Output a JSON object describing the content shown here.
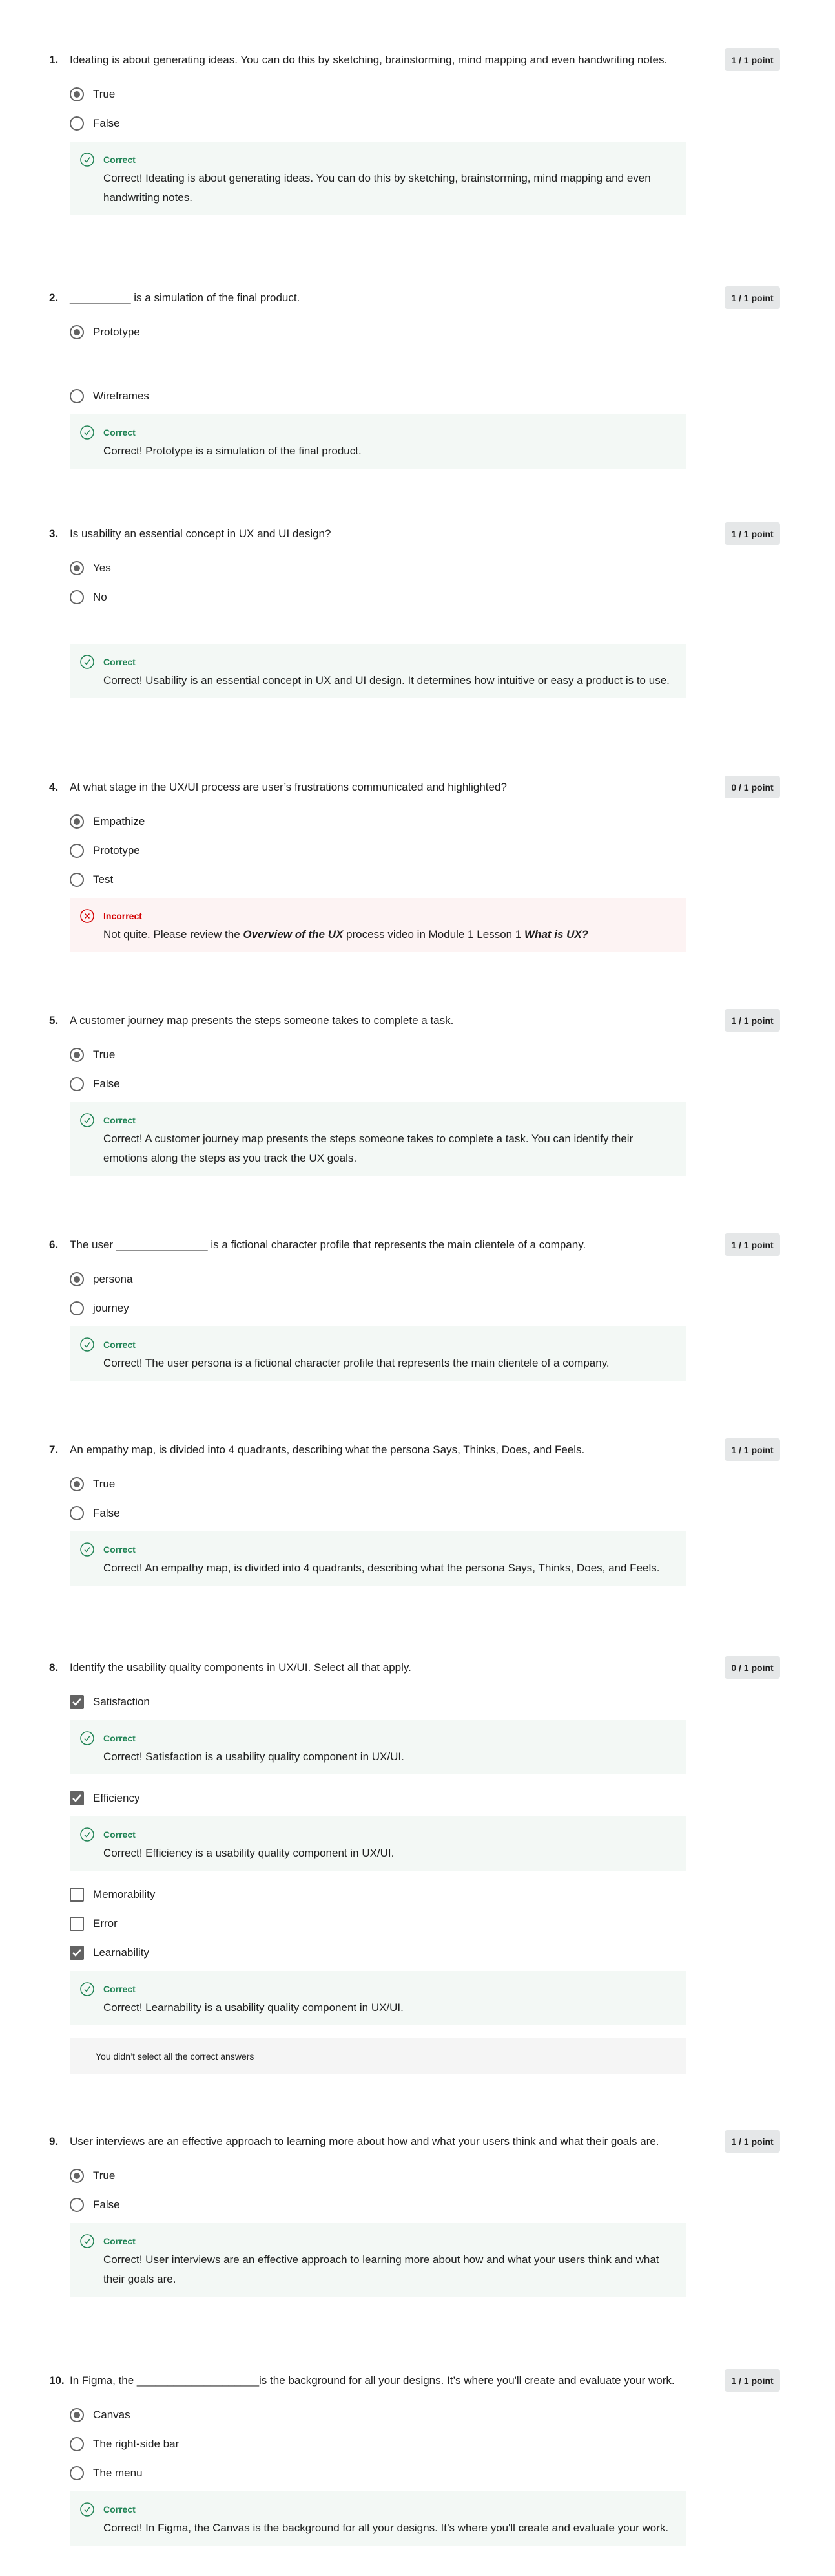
{
  "colors": {
    "correct": "#1f8354",
    "incorrect": "#d30001",
    "correct_bg": "#f3f8f5",
    "incorrect_bg": "#fdf3f3",
    "badge_bg": "#e5e7e8"
  },
  "labels": {
    "correct": "Correct",
    "incorrect": "Incorrect"
  },
  "questions": [
    {
      "num": "1.",
      "text": "Ideating is about generating ideas. You can do this by sketching, brainstorming, mind mapping and even handwriting notes.",
      "score": "1 / 1 point",
      "options": [
        {
          "label": "True",
          "selected": true
        },
        {
          "label": "False",
          "selected": false
        }
      ],
      "feedback": "Correct! Ideating is about generating ideas. You can do this by sketching, brainstorming, mind mapping and even handwriting notes."
    },
    {
      "num": "2.",
      "text": "__________ is a simulation of the final product.",
      "score": "1 / 1 point",
      "options": [
        {
          "label": "Prototype",
          "selected": true
        },
        {
          "label": "Wireframes",
          "selected": false
        }
      ],
      "feedback": "Correct! Prototype is a simulation of the final product."
    },
    {
      "num": "3.",
      "text": "Is usability an essential concept in UX and UI design?",
      "score": "1 / 1 point",
      "options": [
        {
          "label": "Yes",
          "selected": true
        },
        {
          "label": "No",
          "selected": false
        }
      ],
      "feedback": "Correct! Usability is an essential concept in UX and UI design. It determines how intuitive or easy a product is to use."
    },
    {
      "num": "4.",
      "text": "At what stage in the UX/UI process are user’s frustrations communicated and highlighted?",
      "score": "0 / 1 point",
      "options": [
        {
          "label": "Empathize",
          "selected": true
        },
        {
          "label": "Prototype",
          "selected": false
        },
        {
          "label": "Test",
          "selected": false
        }
      ],
      "feedback_parts": [
        "Not quite. Please review the ",
        "Overview of the UX",
        " process video in Module 1 Lesson 1 ",
        "What is UX?"
      ]
    },
    {
      "num": "5.",
      "text": "A customer journey map presents the steps someone takes to complete a task.",
      "score": "1 / 1 point",
      "options": [
        {
          "label": "True",
          "selected": true
        },
        {
          "label": "False",
          "selected": false
        }
      ],
      "feedback": "Correct! A customer journey map presents the steps someone takes to complete a task. You can identify their emotions along the steps as you track the UX goals."
    },
    {
      "num": "6.",
      "text": "The user _______________ is a fictional character profile that represents the main clientele of a company.",
      "score": "1 / 1 point",
      "options": [
        {
          "label": "persona",
          "selected": true
        },
        {
          "label": "journey",
          "selected": false
        }
      ],
      "feedback": "Correct! The user persona is a fictional character profile that represents the main clientele of a company."
    },
    {
      "num": "7.",
      "text": "An empathy map, is divided into 4 quadrants, describing what the persona Says, Thinks, Does, and Feels.",
      "score": "1 / 1 point",
      "options": [
        {
          "label": "True",
          "selected": true
        },
        {
          "label": "False",
          "selected": false
        }
      ],
      "feedback": "Correct! An empathy map, is divided into 4 quadrants, describing what the persona Says, Thinks, Does, and Feels."
    },
    {
      "num": "8.",
      "text": "Identify the usability quality components in UX/UI. Select all that apply.",
      "score": "0 / 1 point",
      "options": [
        {
          "label": "Satisfaction",
          "selected": true,
          "feedback": "Correct! Satisfaction is a usability quality component in UX/UI."
        },
        {
          "label": "Efficiency",
          "selected": true,
          "feedback": "Correct! Efficiency is a usability quality component in UX/UI."
        },
        {
          "label": "Memorability",
          "selected": false
        },
        {
          "label": "Error",
          "selected": false
        },
        {
          "label": "Learnability",
          "selected": true,
          "feedback": "Correct! Learnability is a usability quality component in UX/UI."
        }
      ],
      "note": "You didn’t select all the correct answers"
    },
    {
      "num": "9.",
      "text": "User interviews are an effective approach to learning more about how and what your users think and what their goals are.",
      "score": "1 / 1 point",
      "options": [
        {
          "label": "True",
          "selected": true
        },
        {
          "label": "False",
          "selected": false
        }
      ],
      "feedback": "Correct! User interviews are an effective approach to learning more about how and what your users think and what their goals are."
    },
    {
      "num": "10.",
      "text": "In Figma, the ____________________is the background for all your designs. It’s where you'll create and evaluate your work.",
      "score": "1 / 1 point",
      "options": [
        {
          "label": "Canvas",
          "selected": true
        },
        {
          "label": "The right-side bar",
          "selected": false
        },
        {
          "label": "The menu",
          "selected": false
        }
      ],
      "feedback": "Correct! In Figma, the Canvas is the background for all your designs. It’s where you'll create and evaluate your work."
    }
  ]
}
